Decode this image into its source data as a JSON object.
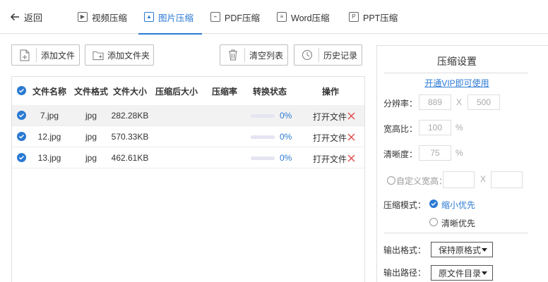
{
  "topbar": {
    "back_label": "返回",
    "tabs": [
      {
        "label": "视频压缩",
        "icon": "video-file-icon"
      },
      {
        "label": "图片压缩",
        "icon": "image-file-icon"
      },
      {
        "label": "PDF压缩",
        "icon": "pdf-file-icon"
      },
      {
        "label": "Word压缩",
        "icon": "word-file-icon"
      },
      {
        "label": "PPT压缩",
        "icon": "ppt-file-icon"
      }
    ],
    "active_tab": "图片压缩"
  },
  "toolbar": {
    "add_file": "添加文件",
    "add_folder": "添加文件夹",
    "clear_list": "清空列表",
    "history": "历史记录"
  },
  "table": {
    "headers": [
      "文件名称",
      "文件格式",
      "文件大小",
      "压缩后大小",
      "压缩率",
      "转换状态",
      "操作"
    ],
    "rows": [
      {
        "name": "7.jpg",
        "format": "jpg",
        "size": "282.28KB",
        "compressed": "",
        "ratio": "",
        "progress": "0%",
        "action": "打开文件"
      },
      {
        "name": "12.jpg",
        "format": "jpg",
        "size": "570.33KB",
        "compressed": "",
        "ratio": "",
        "progress": "0%",
        "action": "打开文件"
      },
      {
        "name": "13.jpg",
        "format": "jpg",
        "size": "462.61KB",
        "compressed": "",
        "ratio": "",
        "progress": "0%",
        "action": "打开文件"
      }
    ]
  },
  "settings": {
    "title": "压缩设置",
    "vip_link": "开通VIP即可使用",
    "resolution_label": "分辨率：",
    "resolution_w": "889",
    "resolution_x": "X",
    "resolution_h": "500",
    "aspect_label": "宽高比：",
    "aspect_value": "100",
    "aspect_unit": "%",
    "clarity_label": "清晰度：",
    "clarity_value": "75",
    "clarity_unit": "%",
    "custom_label": "自定义宽高：",
    "custom_x": "X",
    "mode_label": "压缩模式：",
    "mode_options": [
      "缩小优先",
      "清晰优先"
    ],
    "mode_selected": "缩小优先",
    "output_format_label": "输出格式：",
    "output_format_value": "保持原格式",
    "output_path_label": "输出路径：",
    "output_path_value": "原文件目录"
  },
  "colors": {
    "accent": "#2b7ad3",
    "delete": "#e04848"
  }
}
